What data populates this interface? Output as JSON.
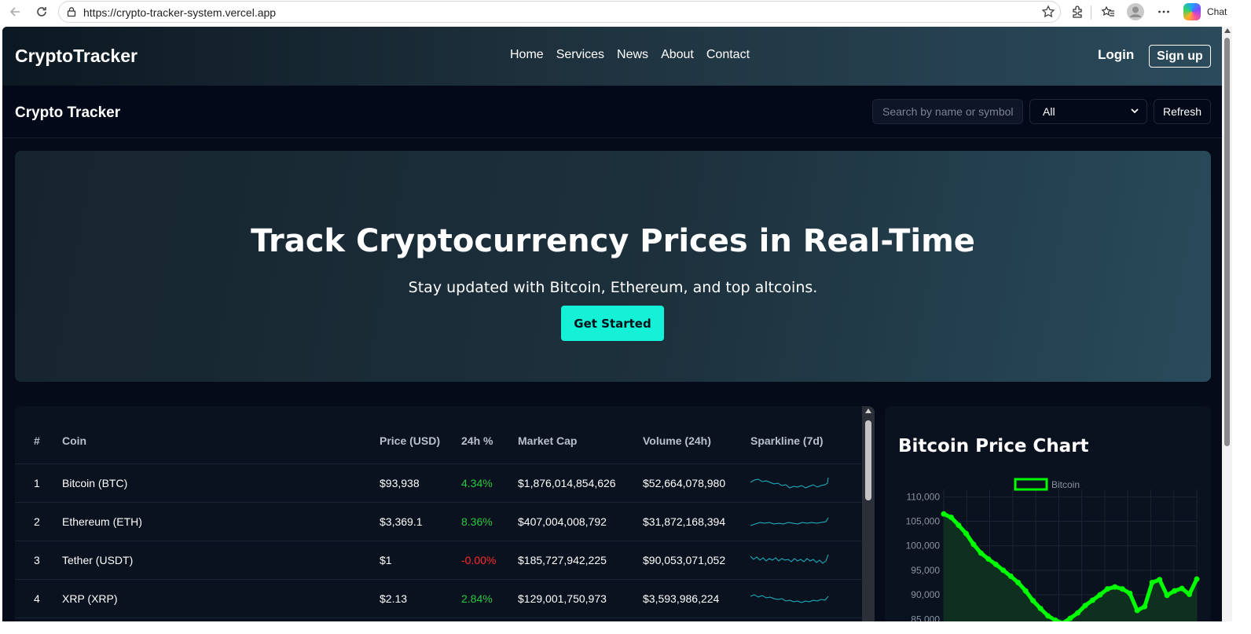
{
  "browser": {
    "url": "https://crypto-tracker-system.vercel.app",
    "chat_label": "Chat"
  },
  "header": {
    "brand": "CryptoTracker",
    "nav": [
      "Home",
      "Services",
      "News",
      "About",
      "Contact"
    ],
    "login": "Login",
    "signup": "Sign up"
  },
  "toolbar": {
    "title": "Crypto Tracker",
    "search_placeholder": "Search by name or symbol",
    "filter_value": "All",
    "refresh_label": "Refresh"
  },
  "hero": {
    "title": "Track Cryptocurrency Prices in Real-Time",
    "subtitle": "Stay updated with Bitcoin, Ethereum, and top altcoins.",
    "cta": "Get Started"
  },
  "table": {
    "headers": [
      "#",
      "Coin",
      "Price (USD)",
      "24h %",
      "Market Cap",
      "Volume (24h)",
      "Sparkline (7d)"
    ],
    "rows": [
      {
        "rank": "1",
        "coin": "Bitcoin (BTC)",
        "price": "$93,938",
        "change": "4.34%",
        "direction": "up",
        "market_cap": "$1,876,014,854,626",
        "volume": "$52,664,078,980"
      },
      {
        "rank": "2",
        "coin": "Ethereum (ETH)",
        "price": "$3,369.1",
        "change": "8.36%",
        "direction": "up",
        "market_cap": "$407,004,008,792",
        "volume": "$31,872,168,394"
      },
      {
        "rank": "3",
        "coin": "Tether (USDT)",
        "price": "$1",
        "change": "-0.00%",
        "direction": "down",
        "market_cap": "$185,727,942,225",
        "volume": "$90,053,071,052"
      },
      {
        "rank": "4",
        "coin": "XRP (XRP)",
        "price": "$2.13",
        "change": "2.84%",
        "direction": "up",
        "market_cap": "$129,001,750,973",
        "volume": "$3,593,986,224"
      }
    ],
    "sparkline_color": "#1fb8c9",
    "positive_color": "#27c93f",
    "negative_color": "#ff2b2b"
  },
  "chart_panel": {
    "title": "Bitcoin Price Chart",
    "chart_data": {
      "type": "line",
      "title": "",
      "xlabel": "",
      "ylabel": "",
      "series": [
        {
          "name": "Bitcoin",
          "color": "#00ff00",
          "values": [
            106500,
            105800,
            104200,
            102500,
            100300,
            98500,
            97300,
            96200,
            95000,
            93800,
            92500,
            90800,
            88800,
            87200,
            85700,
            84800,
            84200,
            85200,
            86300,
            87800,
            88900,
            90000,
            91200,
            91600,
            91200,
            90300,
            86800,
            87600,
            92500,
            93100,
            89900,
            90800,
            91300,
            90100,
            93200
          ]
        }
      ],
      "yticks": [
        85000,
        90000,
        95000,
        100000,
        105000,
        110000
      ],
      "ytick_labels": [
        "85,000",
        "90,000",
        "95,000",
        "100,000",
        "105,000",
        "110,000"
      ],
      "ylim": [
        82000,
        111500
      ],
      "grid": true,
      "legend": "top-center"
    }
  }
}
